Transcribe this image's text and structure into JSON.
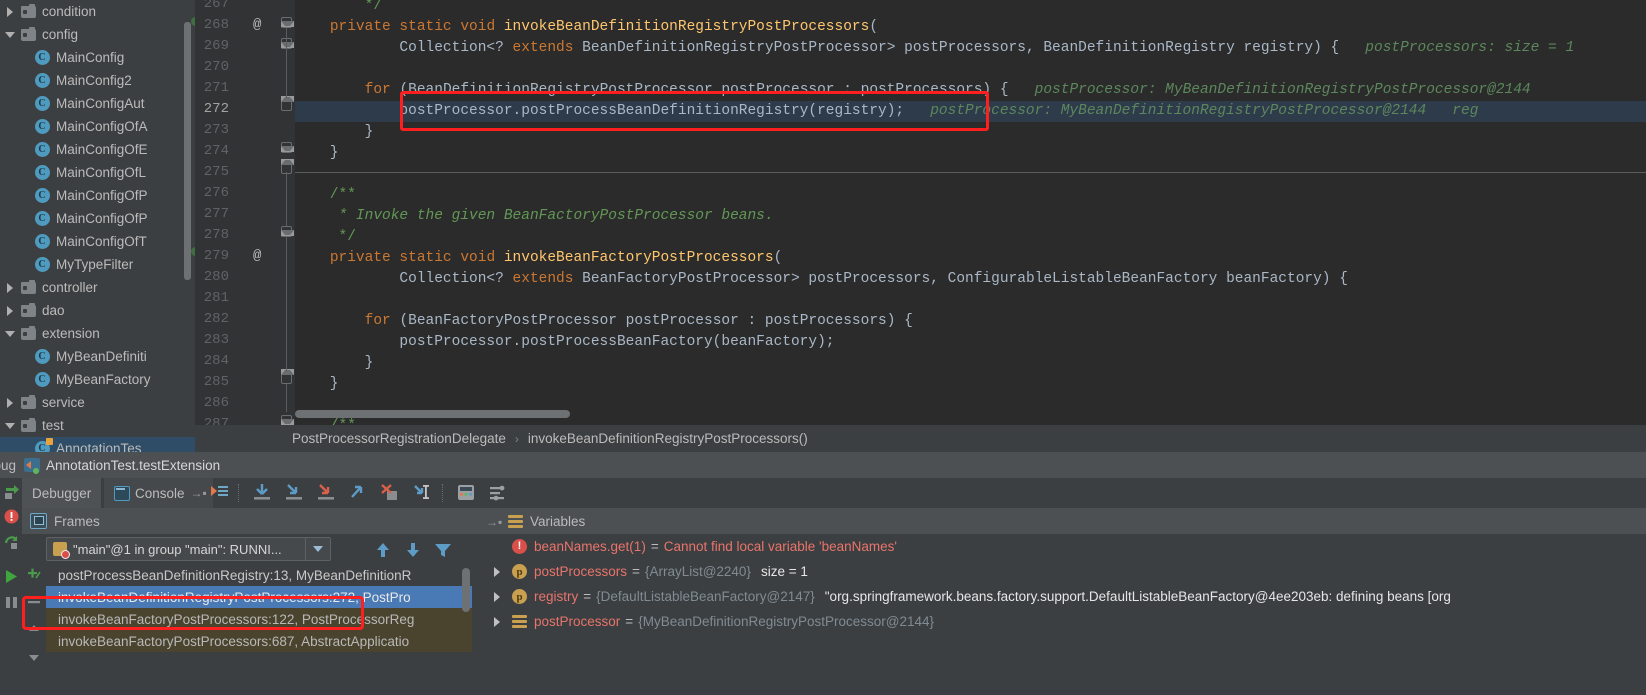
{
  "project_tree": {
    "items": [
      {
        "label": "condition",
        "kind": "folder",
        "twisty": "closed",
        "indent": 0
      },
      {
        "label": "config",
        "kind": "folder",
        "twisty": "open",
        "indent": 0
      },
      {
        "label": "MainConfig",
        "kind": "class",
        "twisty": "none",
        "indent": 1
      },
      {
        "label": "MainConfig2",
        "kind": "class",
        "twisty": "none",
        "indent": 1
      },
      {
        "label": "MainConfigAut",
        "kind": "class",
        "twisty": "none",
        "indent": 1
      },
      {
        "label": "MainConfigOfA",
        "kind": "class",
        "twisty": "none",
        "indent": 1
      },
      {
        "label": "MainConfigOfE",
        "kind": "class",
        "twisty": "none",
        "indent": 1
      },
      {
        "label": "MainConfigOfL",
        "kind": "class",
        "twisty": "none",
        "indent": 1
      },
      {
        "label": "MainConfigOfP",
        "kind": "class",
        "twisty": "none",
        "indent": 1
      },
      {
        "label": "MainConfigOfP",
        "kind": "class",
        "twisty": "none",
        "indent": 1
      },
      {
        "label": "MainConfigOfT",
        "kind": "class",
        "twisty": "none",
        "indent": 1
      },
      {
        "label": "MyTypeFilter",
        "kind": "class",
        "twisty": "none",
        "indent": 1
      },
      {
        "label": "controller",
        "kind": "folder",
        "twisty": "closed",
        "indent": 0
      },
      {
        "label": "dao",
        "kind": "folder",
        "twisty": "closed",
        "indent": 0
      },
      {
        "label": "extension",
        "kind": "folder",
        "twisty": "open",
        "indent": 0
      },
      {
        "label": "MyBeanDefiniti",
        "kind": "class",
        "twisty": "none",
        "indent": 1
      },
      {
        "label": "MyBeanFactory",
        "kind": "class",
        "twisty": "none",
        "indent": 1
      },
      {
        "label": "service",
        "kind": "folder",
        "twisty": "closed",
        "indent": 0
      },
      {
        "label": "test",
        "kind": "folder",
        "twisty": "open",
        "indent": 0
      },
      {
        "label": "AnnotationTes",
        "kind": "test-class",
        "twisty": "none",
        "indent": 1,
        "selected": true
      }
    ]
  },
  "editor": {
    "first_line_number": 267,
    "line_numbers": [
      267,
      268,
      269,
      270,
      271,
      272,
      273,
      274,
      275,
      276,
      277,
      278,
      279,
      280,
      281,
      282,
      283,
      284,
      285,
      286,
      287
    ],
    "current_line": 272,
    "at_markers": [
      268,
      279
    ],
    "highlighted_line": 272,
    "lines": [
      {
        "n": 267,
        "segments": [
          {
            "t": "        */",
            "c": "cmtb"
          }
        ]
      },
      {
        "n": 268,
        "segments": [
          {
            "t": "    ",
            "c": "pun"
          },
          {
            "t": "private static void ",
            "c": "kw"
          },
          {
            "t": "invokeBeanDefinitionRegistryPostProcessors",
            "c": "mth"
          },
          {
            "t": "(",
            "c": "pun"
          }
        ]
      },
      {
        "n": 269,
        "segments": [
          {
            "t": "            Collection<? ",
            "c": "pun"
          },
          {
            "t": "extends ",
            "c": "kw"
          },
          {
            "t": "BeanDefinitionRegistryPostProcessor> postProcessors, BeanDefinitionRegistry registry) {",
            "c": "pun"
          },
          {
            "t": "   postProcessors: size = 1",
            "c": "hint"
          }
        ]
      },
      {
        "n": 270,
        "segments": []
      },
      {
        "n": 271,
        "segments": [
          {
            "t": "        ",
            "c": "pun"
          },
          {
            "t": "for ",
            "c": "kw"
          },
          {
            "t": "(BeanDefinitionRegistryPostProcessor postProcessor : postProcessors) {",
            "c": "pun"
          },
          {
            "t": "   postProcessor: MyBeanDefinitionRegistryPostProcessor@2144",
            "c": "hint"
          }
        ]
      },
      {
        "n": 272,
        "segments": [
          {
            "t": "            postProcessor.postProcessBeanDefinitionRegistry(registry);",
            "c": "pun"
          },
          {
            "t": "   postProcessor: MyBeanDefinitionRegistryPostProcessor@2144   reg",
            "c": "hint"
          }
        ]
      },
      {
        "n": 273,
        "segments": [
          {
            "t": "        }",
            "c": "pun"
          }
        ]
      },
      {
        "n": 274,
        "segments": [
          {
            "t": "    }",
            "c": "pun"
          }
        ]
      },
      {
        "n": 275,
        "segments": []
      },
      {
        "n": 276,
        "segments": [
          {
            "t": "    /**",
            "c": "cmtb"
          }
        ]
      },
      {
        "n": 277,
        "segments": [
          {
            "t": "     * Invoke the given BeanFactoryPostProcessor beans.",
            "c": "cmt"
          }
        ]
      },
      {
        "n": 278,
        "segments": [
          {
            "t": "     */",
            "c": "cmtb"
          }
        ]
      },
      {
        "n": 279,
        "segments": [
          {
            "t": "    ",
            "c": "pun"
          },
          {
            "t": "private static void ",
            "c": "kw"
          },
          {
            "t": "invokeBeanFactoryPostProcessors",
            "c": "mth"
          },
          {
            "t": "(",
            "c": "pun"
          }
        ]
      },
      {
        "n": 280,
        "segments": [
          {
            "t": "            Collection<? ",
            "c": "pun"
          },
          {
            "t": "extends ",
            "c": "kw"
          },
          {
            "t": "BeanFactoryPostProcessor> postProcessors, ConfigurableListableBeanFactory beanFactory) {",
            "c": "pun"
          }
        ]
      },
      {
        "n": 281,
        "segments": []
      },
      {
        "n": 282,
        "segments": [
          {
            "t": "        ",
            "c": "pun"
          },
          {
            "t": "for ",
            "c": "kw"
          },
          {
            "t": "(BeanFactoryPostProcessor postProcessor : postProcessors) {",
            "c": "pun"
          }
        ]
      },
      {
        "n": 283,
        "segments": [
          {
            "t": "            postProcessor.postProcessBeanFactory(beanFactory);",
            "c": "pun"
          }
        ]
      },
      {
        "n": 284,
        "segments": [
          {
            "t": "        }",
            "c": "pun"
          }
        ]
      },
      {
        "n": 285,
        "segments": [
          {
            "t": "    }",
            "c": "pun"
          }
        ]
      },
      {
        "n": 286,
        "segments": []
      },
      {
        "n": 287,
        "segments": [
          {
            "t": "    /**",
            "c": "cmtb"
          }
        ]
      }
    ]
  },
  "breadcrumb": {
    "class": "PostProcessorRegistrationDelegate",
    "separator": "›",
    "method": "invokeBeanDefinitionRegistryPostProcessors()"
  },
  "run_header": {
    "prefix_label": "ebug",
    "title": "AnnotationTest.testExtension"
  },
  "debug_tabs": {
    "debugger": "Debugger",
    "console": "Console"
  },
  "debug_toolbar": {
    "buttons": [
      {
        "name": "show-execution-point-icon",
        "title": "Show Execution Point"
      },
      {
        "name": "step-over-icon",
        "title": "Step Over"
      },
      {
        "name": "step-into-icon",
        "title": "Step Into"
      },
      {
        "name": "force-step-into-icon",
        "title": "Force Step Into"
      },
      {
        "name": "step-out-icon",
        "title": "Step Out"
      },
      {
        "name": "drop-frame-icon",
        "title": "Drop Frame"
      },
      {
        "name": "run-to-cursor-icon",
        "title": "Run to Cursor"
      },
      {
        "name": "evaluate-expression-icon",
        "title": "Evaluate Expression"
      },
      {
        "name": "settings-icon",
        "title": "Layout Settings"
      }
    ]
  },
  "frames": {
    "header": "Frames",
    "thread": "\"main\"@1 in group \"main\": RUNNI...",
    "rows": [
      {
        "label": "postProcessBeanDefinitionRegistry:13, MyBeanDefinitionR",
        "state": "normal"
      },
      {
        "label": "invokeBeanDefinitionRegistryPostProcessors:272, PostPro",
        "state": "selected"
      },
      {
        "label": "invokeBeanFactoryPostProcessors:122, PostProcessorReg",
        "state": "library"
      },
      {
        "label": "invokeBeanFactoryPostProcessors:687, AbstractApplicatio",
        "state": "library"
      }
    ]
  },
  "variables": {
    "header": "Variables",
    "rows": [
      {
        "twisty": "none",
        "icon": "error-icon",
        "name": "beanNames.get(1)",
        "eq": "=",
        "value": "Cannot find local variable 'beanNames'",
        "value_kind": "error",
        "meta": ""
      },
      {
        "twisty": "closed",
        "icon": "parameter-icon",
        "name": "postProcessors",
        "eq": "=",
        "value": "{ArrayList@2240}",
        "value_kind": "ref",
        "meta": "size = 1"
      },
      {
        "twisty": "closed",
        "icon": "parameter-icon",
        "name": "registry",
        "eq": "=",
        "value": "{DefaultListableBeanFactory@2147}",
        "value_kind": "ref",
        "meta": "\"org.springframework.beans.factory.support.DefaultListableBeanFactory@4ee203eb: defining beans [org"
      },
      {
        "twisty": "closed",
        "icon": "object-icon",
        "name": "postProcessor",
        "eq": "=",
        "value": "{MyBeanDefinitionRegistryPostProcessor@2144}",
        "value_kind": "ref",
        "meta": ""
      }
    ]
  },
  "annotations": {
    "code_box_color": "#FF1F1F",
    "frames_box_color": "#FF1F1F"
  },
  "colors": {
    "editor_bg": "#2B2B2B",
    "panel_bg": "#3C3F41",
    "gutter_bg": "#313335",
    "keyword": "#CC7832",
    "method": "#FFC66D",
    "comment": "#629755",
    "inline_hint": "#5F8C5F",
    "text": "#A9B7C6",
    "selection_blue": "#4A7AB5",
    "library_frame": "#4A442E",
    "error_red": "#E8746B"
  }
}
